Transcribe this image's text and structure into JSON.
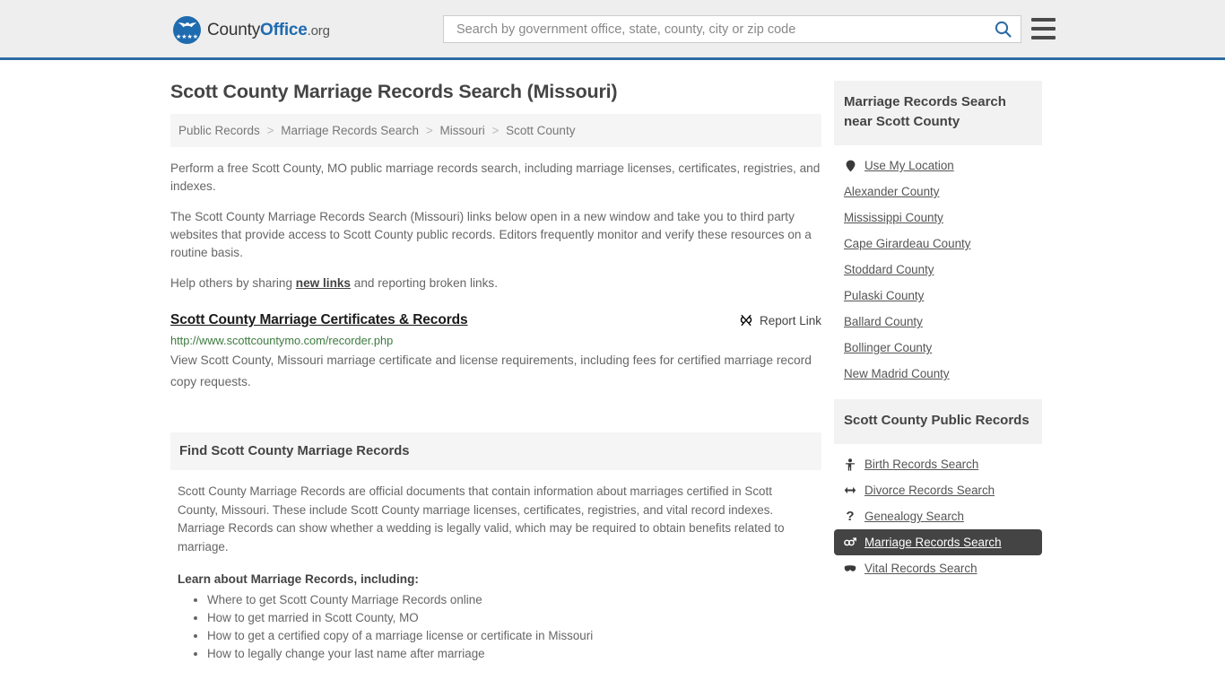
{
  "header": {
    "brand": {
      "part1": "County",
      "part2": "Office",
      "tld": ".org",
      "logo_icon": "eagle-stars-logo",
      "stars": "★★★★"
    },
    "search": {
      "placeholder": "Search by government office, state, county, city or zip code",
      "value": "",
      "search_icon": "search-icon"
    },
    "menu_icon": "hamburger-menu-icon",
    "accent_color": "#2d6ca2"
  },
  "main": {
    "title": "Scott County Marriage Records Search (Missouri)",
    "breadcrumb": {
      "separator": ">",
      "items": [
        {
          "label": "Public Records"
        },
        {
          "label": "Marriage Records Search"
        },
        {
          "label": "Missouri"
        },
        {
          "label": "Scott County"
        }
      ]
    },
    "paragraphs": {
      "p1": "Perform a free Scott County, MO public marriage records search, including marriage licenses, certificates, registries, and indexes.",
      "p2": "The Scott County Marriage Records Search (Missouri) links below open in a new window and take you to third party websites that provide access to Scott County public records. Editors frequently monitor and verify these resources on a routine basis.",
      "p3_before": "Help others by sharing ",
      "p3_link": "new links",
      "p3_after": " and reporting broken links."
    },
    "result": {
      "title": "Scott County Marriage Certificates & Records",
      "report_label": "Report Link",
      "report_icon": "broken-link-icon",
      "url": "http://www.scottcountymo.com/recorder.php",
      "description": "View Scott County, Missouri marriage certificate and license requirements, including fees for certified marriage record copy requests.",
      "url_color": "#3c7a3f"
    },
    "section": {
      "heading": "Find Scott County Marriage Records",
      "body": "Scott County Marriage Records are official documents that contain information about marriages certified in Scott County, Missouri. These include Scott County marriage licenses, certificates, registries, and vital record indexes. Marriage Records can show whether a wedding is legally valid, which may be required to obtain benefits related to marriage.",
      "learn_heading": "Learn about Marriage Records, including:",
      "learn_items": [
        "Where to get Scott County Marriage Records online",
        "How to get married in Scott County, MO",
        "How to get a certified copy of a marriage license or certificate in Missouri",
        "How to legally change your last name after marriage"
      ]
    }
  },
  "sidebar": {
    "nearby": {
      "heading": "Marriage Records Search near Scott County",
      "items": [
        {
          "label": "Use My Location",
          "icon": "map-pin-icon"
        },
        {
          "label": "Alexander County",
          "icon": ""
        },
        {
          "label": "Mississippi County",
          "icon": ""
        },
        {
          "label": "Cape Girardeau County",
          "icon": ""
        },
        {
          "label": "Stoddard County",
          "icon": ""
        },
        {
          "label": "Pulaski County",
          "icon": ""
        },
        {
          "label": "Ballard County",
          "icon": ""
        },
        {
          "label": "Bollinger County",
          "icon": ""
        },
        {
          "label": "New Madrid County",
          "icon": ""
        }
      ]
    },
    "public_records": {
      "heading": "Scott County Public Records",
      "active_color": "#444444",
      "items": [
        {
          "label": "Birth Records Search",
          "icon": "baby-icon",
          "active": false
        },
        {
          "label": "Divorce Records Search",
          "icon": "left-right-arrow-icon",
          "active": false
        },
        {
          "label": "Genealogy Search",
          "icon": "question-mark-icon",
          "active": false
        },
        {
          "label": "Marriage Records Search",
          "icon": "venus-mars-icon",
          "active": true
        },
        {
          "label": "Vital Records Search",
          "icon": "mask-icon",
          "active": false
        }
      ]
    }
  }
}
